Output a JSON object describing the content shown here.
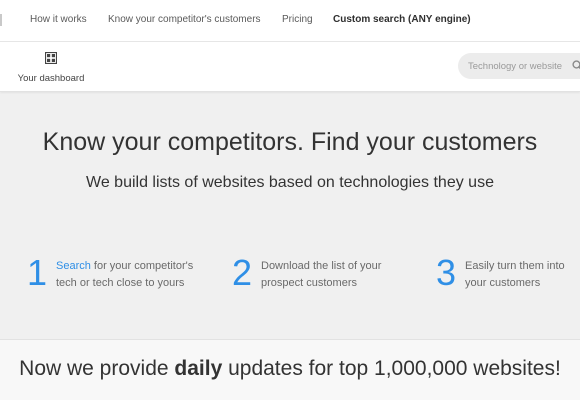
{
  "topnav": {
    "items": [
      "How it works",
      "Know your competitor's customers",
      "Pricing",
      "Custom search (ANY engine)"
    ]
  },
  "subnav": {
    "dashboard_label": "Your dashboard",
    "dashboard_icon": "dashboard-icon"
  },
  "search": {
    "placeholder": "Technology or website",
    "icon": "search-icon"
  },
  "hero": {
    "title": "Know your competitors. Find your customers",
    "subtitle": "We build lists of websites based on technologies they use"
  },
  "steps": [
    {
      "number": "1",
      "link": "Search",
      "text": " for your competitor's tech or tech close to yours"
    },
    {
      "number": "2",
      "link": "",
      "text": "Download the list of your prospect customers"
    },
    {
      "number": "3",
      "link": "",
      "text": "Easily turn them into your customers"
    }
  ],
  "banner": {
    "before": "Now we provide ",
    "bold": "daily",
    "after": " updates for top 1,000,000 websites!"
  },
  "colors": {
    "accent": "#2f8fe6",
    "page_background": "#f0f0f0"
  }
}
